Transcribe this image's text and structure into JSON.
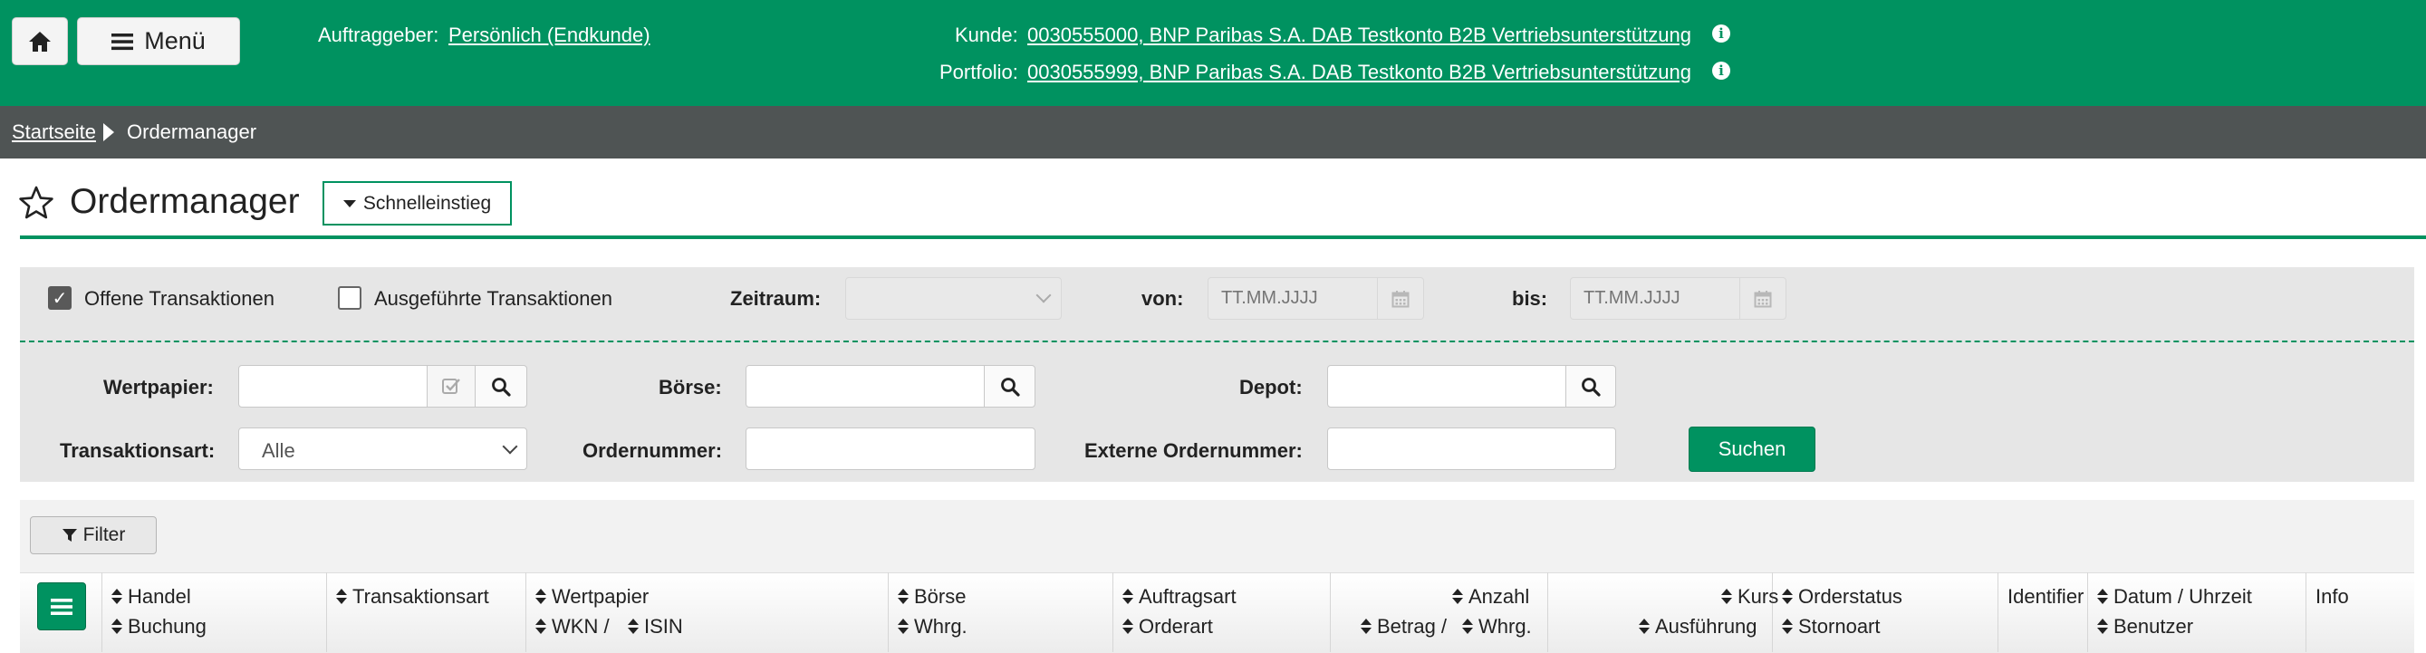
{
  "header": {
    "menu_label": "Menü",
    "client_label": "Auftraggeber:",
    "client_value": "Persönlich (Endkunde)",
    "customer_label": "Kunde:",
    "customer_value": "0030555000, BNP Paribas S.A. DAB Testkonto B2B Vertriebsunterstützung",
    "portfolio_label": "Portfolio:",
    "portfolio_value": "0030555999, BNP Paribas S.A. DAB Testkonto B2B Vertriebsunterstützung"
  },
  "breadcrumb": {
    "home": "Startseite",
    "current": "Ordermanager"
  },
  "page": {
    "title": "Ordermanager",
    "quick_entry": "Schnelleinstieg"
  },
  "filters": {
    "open_tx": {
      "label": "Offene Transaktionen",
      "checked": true
    },
    "executed_tx": {
      "label": "Ausgeführte Transaktionen",
      "checked": false
    },
    "period_label": "Zeitraum:",
    "from_label": "von:",
    "from_placeholder": "TT.MM.JJJJ",
    "to_label": "bis:",
    "to_placeholder": "TT.MM.JJJJ",
    "security_label": "Wertpapier:",
    "exchange_label": "Börse:",
    "depot_label": "Depot:",
    "tx_type_label": "Transaktionsart:",
    "tx_type_value": "Alle",
    "order_number_label": "Ordernummer:",
    "external_order_label": "Externe Ordernummer:",
    "search_button": "Suchen"
  },
  "filter_button": "Filter",
  "table": {
    "columns": [
      {
        "top": "Handel",
        "bottom": "Buchung"
      },
      {
        "top": "Transaktionsart",
        "bottom": ""
      },
      {
        "top": "Wertpapier",
        "bottom_a": "WKN /",
        "bottom_b": "ISIN"
      },
      {
        "top": "Börse",
        "bottom": "Whrg."
      },
      {
        "top": "Auftragsart",
        "bottom": "Orderart"
      },
      {
        "top": "Anzahl",
        "bottom_a": "Betrag /",
        "bottom_b": "Whrg."
      },
      {
        "top": "Kurs",
        "bottom": "Ausführung"
      },
      {
        "top": "Orderstatus",
        "bottom": "Stornoart"
      },
      {
        "top": "Identifier"
      },
      {
        "top": "Datum / Uhrzeit",
        "bottom": "Benutzer"
      },
      {
        "top": "Info"
      }
    ]
  },
  "colors": {
    "brand_green": "#009260",
    "breadcrumb_bg": "#4f5454",
    "panel_bg": "#e6e6e6"
  }
}
